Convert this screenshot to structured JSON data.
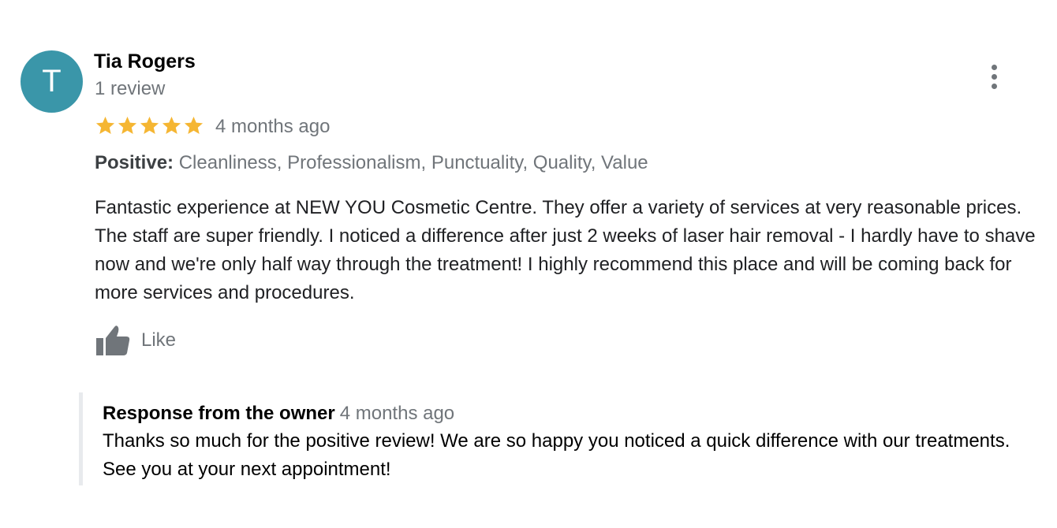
{
  "review": {
    "avatar_initial": "T",
    "avatar_color": "#3a96a9",
    "author_name": "Tia Rogers",
    "review_count": "1 review",
    "rating": 5,
    "rating_max": 5,
    "star_color": "#f5b633",
    "time_ago": "4 months ago",
    "positive_label": "Positive:",
    "positive_items": "Cleanliness, Professionalism, Punctuality, Quality, Value",
    "text": "Fantastic experience at NEW YOU Cosmetic Centre. They offer a variety of services at very reasonable prices. The staff are super friendly. I noticed a difference after just 2 weeks of laser hair removal - I hardly have to shave now and we're only half way through the treatment! I highly recommend this place and will be coming back for more services and procedures.",
    "like_label": "Like",
    "like_icon": "thumbs-up-icon",
    "more_icon": "more-vertical-icon"
  },
  "owner_response": {
    "title": "Response from the owner",
    "time_ago": "4 months ago",
    "text": "Thanks so much for the positive review! We are so happy you noticed a quick difference with our treatments. See you at your next appointment!"
  }
}
